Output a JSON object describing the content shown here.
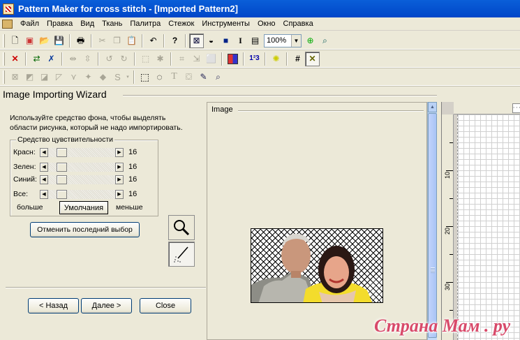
{
  "window": {
    "title": "Pattern Maker for cross stitch - [Imported Pattern2]"
  },
  "menu": [
    "Файл",
    "Правка",
    "Вид",
    "Ткань",
    "Палитра",
    "Стежок",
    "Инструменты",
    "Окно",
    "Справка"
  ],
  "toolbar": {
    "zoom_value": "100%"
  },
  "wizard": {
    "title": "Image Importing Wizard",
    "instruction_line1": "Используйте средство фона, чтобы выделять",
    "instruction_line2": "области рисунка, который не надо импортировать.",
    "group_title": "Средство цувствительности",
    "sliders": [
      {
        "label": "Красн:",
        "value": "16"
      },
      {
        "label": "Зелен:",
        "value": "16"
      },
      {
        "label": "Синий:",
        "value": "16"
      },
      {
        "label": "Все:",
        "value": "16"
      }
    ],
    "more_label": "больше",
    "defaults_button": "Умолчания",
    "less_label": "меньше",
    "undo_button": "Отменить последний выбор",
    "back_button": "< Назад",
    "next_button": "Далее >",
    "close_button": "Close"
  },
  "image_panel": {
    "title": "Image"
  },
  "ruler": {
    "labels": [
      "10",
      "20",
      "30"
    ]
  },
  "watermark": "Страна Мам . ру"
}
